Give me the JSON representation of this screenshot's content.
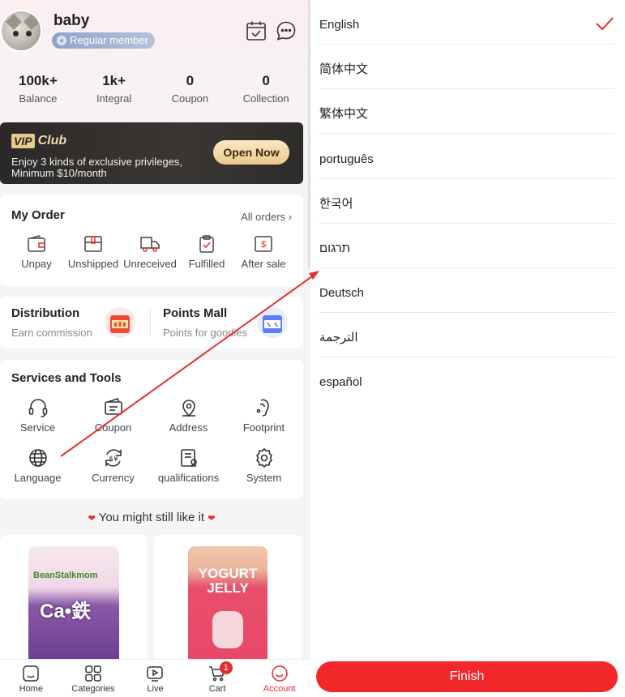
{
  "user": {
    "name": "baby",
    "level": "Regular member"
  },
  "stats": [
    {
      "value": "100k+",
      "label": "Balance"
    },
    {
      "value": "1k+",
      "label": "Integral"
    },
    {
      "value": "0",
      "label": "Coupon"
    },
    {
      "value": "0",
      "label": "Collection"
    }
  ],
  "vip": {
    "badge": "VIP",
    "club": "Club",
    "line1": "Enjoy 3 kinds of exclusive privileges,",
    "line2": "Minimum $10/month",
    "button": "Open Now"
  },
  "my_order": {
    "title": "My Order",
    "all": "All orders",
    "items": [
      "Unpay",
      "Unshipped",
      "Unreceived",
      "Fulfilled",
      "After sale"
    ]
  },
  "distribution": {
    "title": "Distribution",
    "sub": "Earn commission"
  },
  "points_mall": {
    "title": "Points Mall",
    "sub": "Points for goodies"
  },
  "services": {
    "title": "Services and Tools",
    "row1": [
      "Service",
      "Coupon",
      "Address",
      "Footprint"
    ],
    "row2": [
      "Language",
      "Currency",
      "qualifications",
      "System"
    ]
  },
  "might_like": "You might still like it",
  "products": [
    {
      "brand": "BeanStalkmom",
      "title": "Ca•鉄"
    },
    {
      "title1": "YOGURT",
      "title2": "JELLY"
    }
  ],
  "tabbar": {
    "items": [
      "Home",
      "Categories",
      "Live",
      "Cart",
      "Account"
    ],
    "cart_count": "1",
    "active": "Account"
  },
  "languages": [
    "English",
    "简体中文",
    "繁体中文",
    "português",
    "한국어",
    "תרגום",
    "Deutsch",
    "الترجمة",
    "español"
  ],
  "selected_language": "English",
  "finish_label": "Finish",
  "colors": {
    "accent": "#f2272a",
    "vip_gold": "#efd9ad",
    "member_badge": "#8fa3c8"
  }
}
